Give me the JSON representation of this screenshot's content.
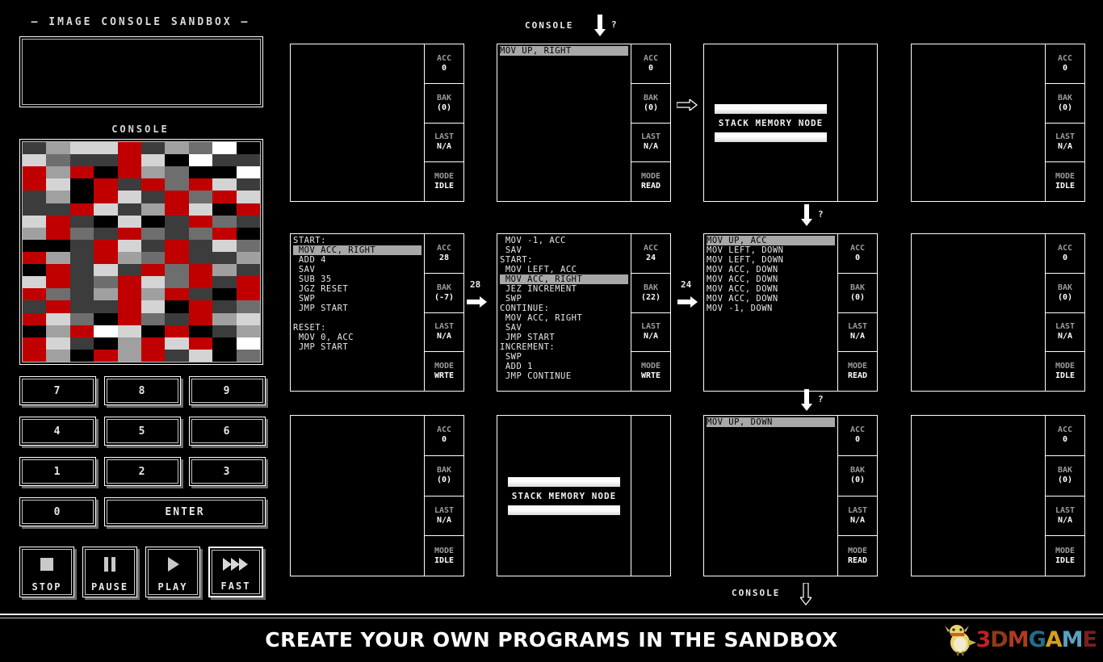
{
  "left_panel": {
    "title": "— IMAGE CONSOLE SANDBOX —",
    "console_label": "CONSOLE",
    "display_value": "",
    "keypad": [
      {
        "label": "7",
        "name": "key-7"
      },
      {
        "label": "8",
        "name": "key-8"
      },
      {
        "label": "9",
        "name": "key-9"
      },
      {
        "label": "4",
        "name": "key-4"
      },
      {
        "label": "5",
        "name": "key-5"
      },
      {
        "label": "6",
        "name": "key-6"
      },
      {
        "label": "1",
        "name": "key-1"
      },
      {
        "label": "2",
        "name": "key-2"
      },
      {
        "label": "3",
        "name": "key-3"
      },
      {
        "label": "0",
        "name": "key-0"
      },
      {
        "label": "ENTER",
        "name": "key-enter"
      }
    ],
    "transport": [
      {
        "label": "STOP",
        "icon": "stop-square-icon",
        "active": false
      },
      {
        "label": "PAUSE",
        "icon": "pause-bars-icon",
        "active": false
      },
      {
        "label": "PLAY",
        "icon": "play-triangle-icon",
        "active": false
      },
      {
        "label": "FAST",
        "icon": "fast-forward-icon",
        "active": true
      }
    ]
  },
  "colors": {
    "red": "#c00000",
    "white": "#ffffff",
    "black": "#000000",
    "accent_highlight": "#a8a8a8",
    "frame": "#ffffff"
  },
  "image_console": {
    "columns": 10,
    "rows": 18,
    "palette": {
      "0": "#000000",
      "1": "#3c3c3c",
      "2": "#6e6e6e",
      "3": "#a0a0a0",
      "4": "#d4d4d4",
      "5": "#ffffff",
      "R": "#c00000"
    },
    "pixels": [
      "1344R1325 1",
      "4211R40511",
      "R3R0R32005",
      "R40R1R2R41",
      "130R41R2R4",
      "11R413R40R",
      "4R10401R21",
      "3R21R212R0",
      "001R41R142",
      "R31R32R113",
      "0R141R2R31",
      "4R12R42R1R",
      "R213R3R10R",
      "1R11R40R12",
      "R420R21R34",
      "03R540R013",
      "R4103R4R05",
      "R30R3R1402"
    ]
  },
  "io_labels": {
    "top_console": "CONSOLE",
    "bottom_console": "CONSOLE"
  },
  "connectors": {
    "row2_left_value": "28",
    "row2_mid_value": "24",
    "question": "?"
  },
  "nodes": [
    {
      "id": "n-r1c1",
      "type": "compute",
      "row": 1,
      "col": 1,
      "code": [],
      "highlight": -1,
      "acc": "0",
      "bak": "(0)",
      "last": "N/A",
      "mode": "IDLE"
    },
    {
      "id": "n-r1c2",
      "type": "compute",
      "row": 1,
      "col": 2,
      "code": [
        "MOV UP, RIGHT"
      ],
      "highlight": 0,
      "acc": "0",
      "bak": "(0)",
      "last": "N/A",
      "mode": "READ"
    },
    {
      "id": "n-r1c3",
      "type": "memory",
      "row": 1,
      "col": 3,
      "label": "STACK MEMORY NODE"
    },
    {
      "id": "n-r1c4",
      "type": "compute",
      "row": 1,
      "col": 4,
      "code": [],
      "highlight": -1,
      "acc": "0",
      "bak": "(0)",
      "last": "N/A",
      "mode": "IDLE"
    },
    {
      "id": "n-r2c1",
      "type": "compute",
      "row": 2,
      "col": 1,
      "code": [
        "START:",
        " MOV ACC, RIGHT",
        " ADD 4",
        " SAV",
        " SUB 35",
        " JGZ RESET",
        " SWP",
        " JMP START",
        "",
        "RESET:",
        " MOV 0, ACC",
        " JMP START"
      ],
      "highlight": 1,
      "acc": "28",
      "bak": "(-7)",
      "last": "N/A",
      "mode": "WRTE"
    },
    {
      "id": "n-r2c2",
      "type": "compute",
      "row": 2,
      "col": 2,
      "code": [
        " MOV -1, ACC",
        " SAV",
        "START:",
        " MOV LEFT, ACC",
        " MOV ACC, RIGHT",
        " JEZ INCREMENT",
        " SWP",
        "CONTINUE:",
        " MOV ACC, RIGHT",
        " SAV",
        " JMP START",
        "INCREMENT:",
        " SWP",
        " ADD 1",
        " JMP CONTINUE"
      ],
      "highlight": 4,
      "acc": "24",
      "bak": "(22)",
      "last": "N/A",
      "mode": "WRTE"
    },
    {
      "id": "n-r2c3",
      "type": "compute",
      "row": 2,
      "col": 3,
      "code": [
        "MOV UP, ACC",
        "MOV LEFT, DOWN",
        "MOV LEFT, DOWN",
        "MOV ACC, DOWN",
        "MOV ACC, DOWN",
        "MOV ACC, DOWN",
        "MOV ACC, DOWN",
        "MOV -1, DOWN"
      ],
      "highlight": 0,
      "acc": "0",
      "bak": "(0)",
      "last": "N/A",
      "mode": "READ"
    },
    {
      "id": "n-r2c4",
      "type": "compute",
      "row": 2,
      "col": 4,
      "code": [],
      "highlight": -1,
      "acc": "0",
      "bak": "(0)",
      "last": "N/A",
      "mode": "IDLE"
    },
    {
      "id": "n-r3c1",
      "type": "compute",
      "row": 3,
      "col": 1,
      "code": [],
      "highlight": -1,
      "acc": "0",
      "bak": "(0)",
      "last": "N/A",
      "mode": "IDLE"
    },
    {
      "id": "n-r3c2",
      "type": "memory",
      "row": 3,
      "col": 2,
      "label": "STACK MEMORY NODE"
    },
    {
      "id": "n-r3c3",
      "type": "compute",
      "row": 3,
      "col": 3,
      "code": [
        "MOV UP, DOWN"
      ],
      "highlight": 0,
      "acc": "0",
      "bak": "(0)",
      "last": "N/A",
      "mode": "READ"
    },
    {
      "id": "n-r3c4",
      "type": "compute",
      "row": 3,
      "col": 4,
      "code": [],
      "highlight": -1,
      "acc": "0",
      "bak": "(0)",
      "last": "N/A",
      "mode": "IDLE"
    }
  ],
  "register_names": {
    "acc": "ACC",
    "bak": "BAK",
    "last": "LAST",
    "mode": "MODE"
  },
  "banner": {
    "text": "CREATE YOUR OWN PROGRAMS IN THE SANDBOX",
    "logo": {
      "segments": [
        {
          "t": "3",
          "c": "lg-3"
        },
        {
          "t": "D",
          "c": "lg-d"
        },
        {
          "t": "M",
          "c": "lg-m"
        },
        {
          "t": "G",
          "c": "lg-g"
        },
        {
          "t": "A",
          "c": "lg-a"
        },
        {
          "t": "M",
          "c": "lg-m2"
        },
        {
          "t": "E",
          "c": "lg-e"
        }
      ]
    }
  }
}
